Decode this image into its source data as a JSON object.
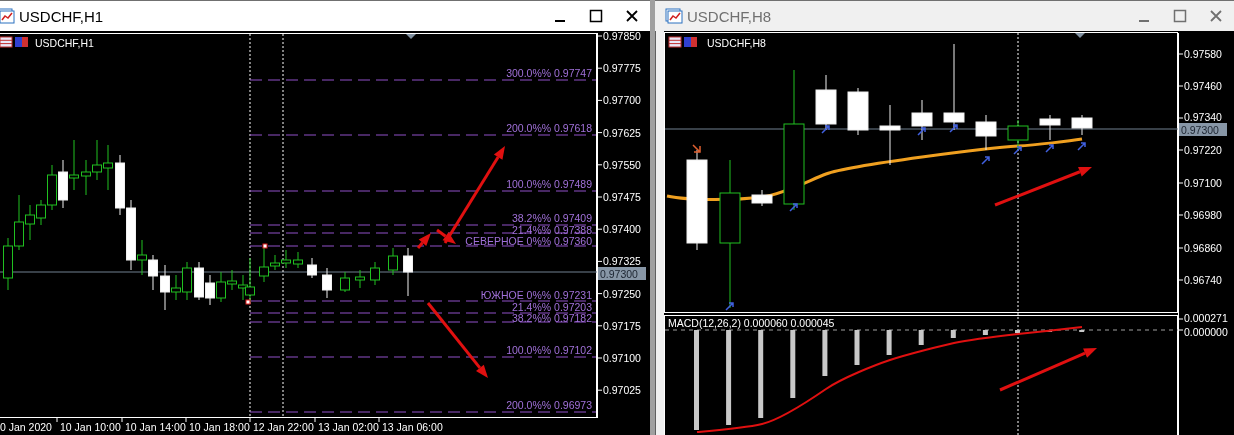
{
  "windows": [
    {
      "title": "USDCHF,H1",
      "active": true,
      "chart_label": "USDCHF,H1",
      "current_price": "0.97300",
      "price_axis": [
        "0.97850",
        "0.97775",
        "0.97700",
        "0.97625",
        "0.97550",
        "0.97475",
        "0.97400",
        "0.97325",
        "0.97250",
        "0.97175",
        "0.97100",
        "0.97025"
      ],
      "fibonacci_levels": [
        {
          "label": "300.0%% 0.97747"
        },
        {
          "label": "200.0%% 0.97618"
        },
        {
          "label": "100.0%% 0.97489"
        },
        {
          "label": "38.2%% 0.97409"
        },
        {
          "label": "21.4%% 0.97388"
        },
        {
          "label": "СЕВЕРНОЕ 0%% 0.97360"
        },
        {
          "label": "ЮЖНОЕ 0%% 0.97231"
        },
        {
          "label": "21.4%% 0.97203"
        },
        {
          "label": "38.2%% 0.97182"
        },
        {
          "label": "100.0%% 0.97102"
        },
        {
          "label": "200.0%% 0.96973"
        }
      ],
      "time_axis": [
        "0 Jan 2020",
        "10 Jan 10:00",
        "10 Jan 14:00",
        "10 Jan 18:00",
        "12 Jan 22:00",
        "13 Jan 02:00",
        "13 Jan 06:00"
      ]
    },
    {
      "title": "USDCHF,H8",
      "active": false,
      "chart_label": "USDCHF,H8",
      "current_price": "0.97300",
      "price_axis": [
        "0.97580",
        "0.97460",
        "0.97340",
        "0.97220",
        "0.97100",
        "0.96980",
        "0.96860",
        "0.96740"
      ],
      "indicator": {
        "label": "MACD(12,26,2) 0.000060 0.000045",
        "axis": [
          "0.000271",
          "0.000000"
        ]
      }
    }
  ]
}
